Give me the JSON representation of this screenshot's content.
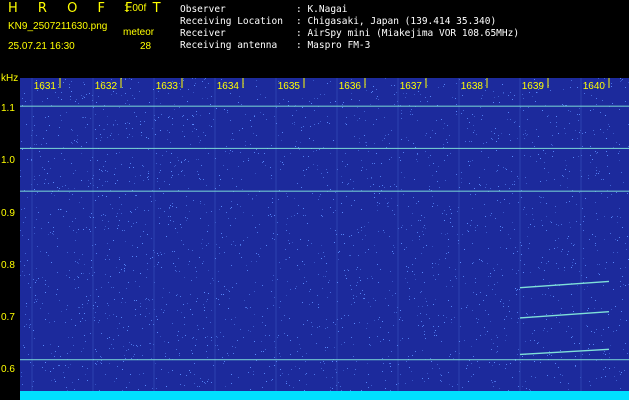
{
  "header": {
    "app_name": "H R O F F T",
    "version": "1.00f",
    "file_name": "KN9_2507211630.png",
    "mode_label": "meteor",
    "datetime": "25.07.21 16:30",
    "count": "28"
  },
  "info": {
    "observer_label": "Observer",
    "observer_value": ": K.Nagai",
    "location_label": "Receiving Location",
    "location_value": ": Chigasaki, Japan (139.414 35.340)",
    "receiver_label": "Receiver",
    "receiver_value": ": AirSpy mini (Miakejima VOR 108.65MHz)",
    "antenna_label": "Receiving antenna",
    "antenna_value": ": Maspro FM-3"
  },
  "chart_data": {
    "type": "heatmap",
    "ylabel": "kHz",
    "y_ticks": [
      "1.1",
      "1.0",
      "0.9",
      "0.8",
      "0.7",
      "0.6"
    ],
    "x_ticks": [
      "1631",
      "1632",
      "1633",
      "1634",
      "1635",
      "1636",
      "1637",
      "1638",
      "1639",
      "1640"
    ],
    "ylim": [
      0.56,
      1.16
    ],
    "background_color": "#1c2a9c",
    "noise_color": "#5a8cff",
    "line_color": "#7fe0d8",
    "horizontal_lines_khz": [
      1.106,
      1.025,
      0.943,
      0.62
    ],
    "meteor_echoes": [
      {
        "x_start": "1639",
        "x_end": "1640",
        "f_start_khz": 0.758,
        "f_end_khz": 0.77
      },
      {
        "x_start": "1639",
        "x_end": "1640",
        "f_start_khz": 0.7,
        "f_end_khz": 0.712
      },
      {
        "x_start": "1639",
        "x_end": "1640",
        "f_start_khz": 0.63,
        "f_end_khz": 0.64
      }
    ]
  },
  "colors": {
    "label_yellow": "#ffff00",
    "bottom_strip": "#00e0ff"
  }
}
